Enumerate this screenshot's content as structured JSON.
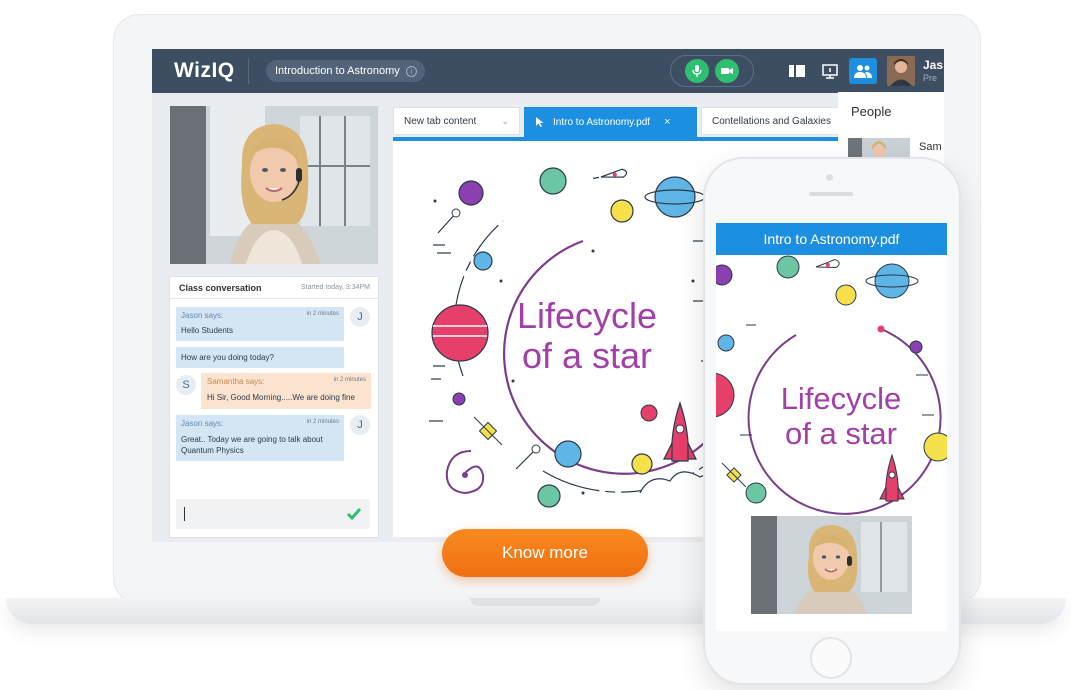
{
  "app": {
    "logo": "WizIQ",
    "class_title": "Introduction to Astronomy",
    "user_name": "Jas",
    "user_role": "Pre"
  },
  "people_panel": {
    "title": "People",
    "first_person": "Sam"
  },
  "chat": {
    "title": "Class conversation",
    "started": "Started today, 3:34PM",
    "messages": [
      {
        "sender": "Jason",
        "says": "says:",
        "time": "in 2 minutes",
        "text": "Hello Students",
        "badge": "J"
      },
      {
        "sender": "",
        "says": "",
        "time": "",
        "text": "How are you doing today?",
        "badge": ""
      },
      {
        "sender": "Samantha",
        "says": "says:",
        "time": "in 2 minutes",
        "text": "Hi Sir, Good Morning.....We are doing fine",
        "badge": "S"
      },
      {
        "sender": "Jason",
        "says": "says:",
        "time": "in 2 minutes",
        "text": "Great.. Today we are going to talk about Quantum Physics",
        "badge": "J"
      }
    ],
    "input_value": ""
  },
  "tabs": [
    {
      "label": "New tab content",
      "active": false,
      "icon": "chevron-down-icon"
    },
    {
      "label": "Intro to Astronomy.pdf",
      "active": true,
      "icon": "cursor-icon",
      "close": "×"
    },
    {
      "label": "Contellations and Galaxies",
      "active": false
    }
  ],
  "document": {
    "title_line1": "Lifecycle",
    "title_line2": "of a star"
  },
  "cta": {
    "label": "Know more"
  },
  "phone": {
    "header": "Intro to Astronomy.pdf",
    "title_line1": "Lifecycle",
    "title_line2": "of a star"
  },
  "colors": {
    "topbar": "#3d4e62",
    "accent": "#1d8fe0",
    "cta": "#f98a1f",
    "title": "#a23fa8",
    "mic_cam": "#2fbf71"
  },
  "icons": [
    "mic-icon",
    "camera-icon",
    "layout-icon",
    "screen-share-icon",
    "people-icon",
    "info-icon",
    "check-icon",
    "rocket-icon",
    "satellite-icon",
    "planet-icon",
    "galaxy-icon"
  ]
}
